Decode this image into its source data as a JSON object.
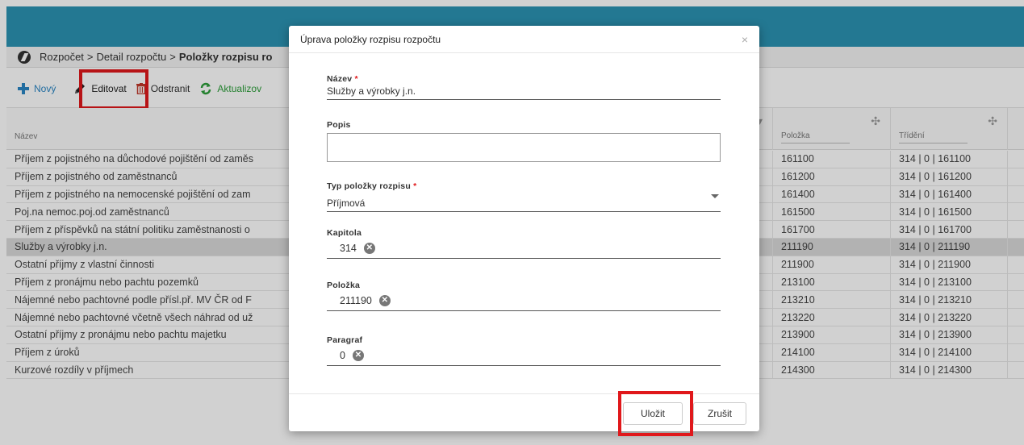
{
  "breadcrumb": {
    "items": [
      "Rozpočet",
      "Detail rozpočtu"
    ],
    "separator": ">",
    "current": "Položky rozpisu ro"
  },
  "toolbar": {
    "new_label": "Nový",
    "edit_label": "Editovat",
    "delete_label": "Odstranit",
    "refresh_label": "Aktualizov"
  },
  "grid": {
    "columns": {
      "name": "Název",
      "polozka": "Položka",
      "trideni": "Třídění"
    },
    "rows": [
      {
        "name": "Příjem z pojistného na důchodové pojištění od zaměs",
        "polozka": "161100",
        "trideni": "314 | 0 | 161100"
      },
      {
        "name": "Příjem z pojistného od zaměstnanců",
        "polozka": "161200",
        "trideni": "314 | 0 | 161200"
      },
      {
        "name": "Příjem z pojistného na nemocenské pojištění od zam",
        "polozka": "161400",
        "trideni": "314 | 0 | 161400"
      },
      {
        "name": "Poj.na nemoc.poj.od zaměstnanců",
        "polozka": "161500",
        "trideni": "314 | 0 | 161500"
      },
      {
        "name": "Příjem z příspěvků na státní politiku zaměstnanosti o",
        "polozka": "161700",
        "trideni": "314 | 0 | 161700"
      },
      {
        "name": "Služby a výrobky j.n.",
        "polozka": "211190",
        "trideni": "314 | 0 | 211190"
      },
      {
        "name": "Ostatní příjmy z vlastní činnosti",
        "polozka": "211900",
        "trideni": "314 | 0 | 211900"
      },
      {
        "name": "Příjem z pronájmu nebo pachtu pozemků",
        "polozka": "213100",
        "trideni": "314 | 0 | 213100"
      },
      {
        "name": "Nájemné nebo pachtovné podle přísl.př. MV ČR od F",
        "polozka": "213210",
        "trideni": "314 | 0 | 213210"
      },
      {
        "name": "Nájemné nebo pachtovné včetně všech náhrad od už",
        "polozka": "213220",
        "trideni": "314 | 0 | 213220"
      },
      {
        "name": "Ostatní příjmy z pronájmu nebo pachtu majetku",
        "polozka": "213900",
        "trideni": "314 | 0 | 213900"
      },
      {
        "name": "Příjem z úroků",
        "polozka": "214100",
        "trideni": "314 | 0 | 214100"
      },
      {
        "name": "Kurzové rozdíly v příjmech",
        "polozka": "214300",
        "trideni": "314 | 0 | 214300"
      }
    ],
    "selected_row_index": 5
  },
  "modal": {
    "title": "Úprava položky rozpisu rozpočtu",
    "close_symbol": "×",
    "required_mark": "*",
    "fields": {
      "nazev": {
        "label": "Název",
        "value": "Služby a výrobky j.n."
      },
      "popis": {
        "label": "Popis",
        "value": ""
      },
      "typ": {
        "label": "Typ položky rozpisu",
        "value": "Příjmová"
      },
      "kapitola": {
        "label": "Kapitola",
        "value": "314"
      },
      "polozka": {
        "label": "Položka",
        "value": "211190"
      },
      "paragraf": {
        "label": "Paragraf",
        "value": "0"
      }
    },
    "save_label": "Uložit",
    "cancel_label": "Zrušit"
  },
  "colors": {
    "header_bar": "#2b93b3",
    "highlight": "#e0181b",
    "selected_row": "#d9d9d9"
  }
}
